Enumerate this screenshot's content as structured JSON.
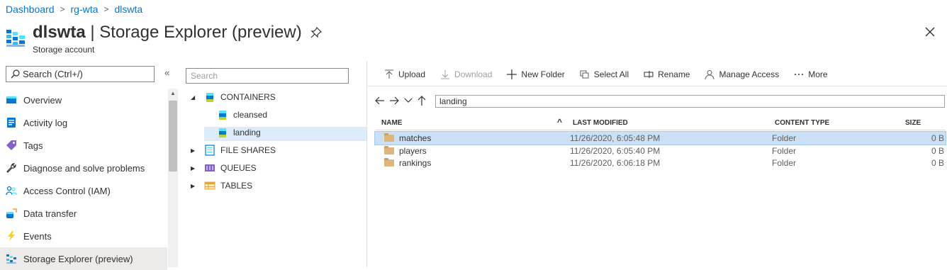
{
  "breadcrumb": {
    "items": [
      "Dashboard",
      "rg-wta",
      "dlswta"
    ],
    "separator": ">"
  },
  "header": {
    "resource_name": "dlswta",
    "separator": " | ",
    "blade_title": "Storage Explorer (preview)",
    "subtitle": "Storage account",
    "pin_icon": "pin-icon",
    "close_icon": "close-icon"
  },
  "nav": {
    "search_placeholder": "Search (Ctrl+/)",
    "collapse_glyph": "«",
    "items": [
      {
        "label": "Overview",
        "icon": "overview-icon"
      },
      {
        "label": "Activity log",
        "icon": "activity-log-icon"
      },
      {
        "label": "Tags",
        "icon": "tag-icon"
      },
      {
        "label": "Diagnose and solve problems",
        "icon": "wrench-icon"
      },
      {
        "label": "Access Control (IAM)",
        "icon": "people-icon"
      },
      {
        "label": "Data transfer",
        "icon": "data-transfer-icon"
      },
      {
        "label": "Events",
        "icon": "lightning-icon"
      },
      {
        "label": "Storage Explorer (preview)",
        "icon": "storage-explorer-icon",
        "selected": true
      }
    ]
  },
  "tree": {
    "search_placeholder": "Search",
    "nodes": [
      {
        "label": "CONTAINERS",
        "expanded": true
      },
      {
        "label": "cleansed"
      },
      {
        "label": "landing",
        "selected": true
      },
      {
        "label": "FILE SHARES",
        "expanded": false
      },
      {
        "label": "QUEUES",
        "expanded": false
      },
      {
        "label": "TABLES",
        "expanded": false
      }
    ]
  },
  "toolbar": {
    "upload": "Upload",
    "download": "Download",
    "new_folder": "New Folder",
    "select_all": "Select All",
    "rename": "Rename",
    "manage_access": "Manage Access",
    "more": "More"
  },
  "address": {
    "path": "landing"
  },
  "table": {
    "headers": {
      "name": "NAME",
      "modified": "LAST MODIFIED",
      "type": "CONTENT TYPE",
      "size": "SIZE"
    },
    "sort_glyph": "^",
    "rows": [
      {
        "name": "matches",
        "modified": "11/26/2020, 6:05:48 PM",
        "type": "Folder",
        "size": "0 B",
        "selected": true
      },
      {
        "name": "players",
        "modified": "11/26/2020, 6:05:40 PM",
        "type": "Folder",
        "size": "0 B"
      },
      {
        "name": "rankings",
        "modified": "11/26/2020, 6:06:18 PM",
        "type": "Folder",
        "size": "0 B"
      }
    ]
  },
  "colors": {
    "accent": "#0078d4",
    "row_selected": "#cce0f5",
    "tree_selected": "#deecf9",
    "nav_selected": "#edebe9"
  }
}
